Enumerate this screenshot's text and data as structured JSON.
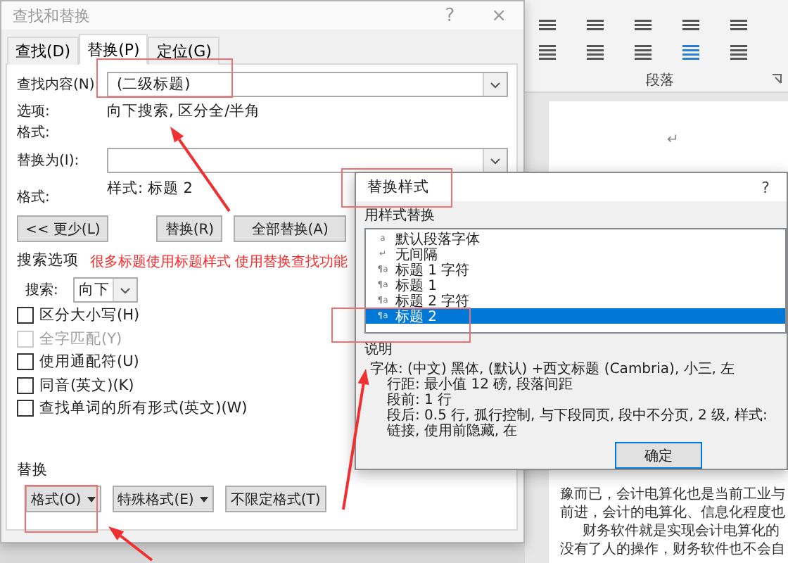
{
  "main_dialog": {
    "title": "查找和替换",
    "help": "?",
    "close": "×",
    "tabs": [
      {
        "label": "查找(D)",
        "selected": false
      },
      {
        "label": "替换(P)",
        "selected": true
      },
      {
        "label": "定位(G)",
        "selected": false
      }
    ],
    "find": {
      "label": "查找内容(N):",
      "value": "(二级标题)"
    },
    "options": {
      "label": "选项:",
      "value": "向下搜索, 区分全/半角"
    },
    "find_format": {
      "label": "格式:"
    },
    "replace": {
      "label": "替换为(I):"
    },
    "replace_format": {
      "label": "格式:",
      "value": "样式: 标题 2"
    },
    "buttons": [
      "<< 更少(L)",
      "替换(R)",
      "全部替换(A)"
    ],
    "search_options": {
      "title": "搜索选项",
      "direction_label": "搜索:",
      "direction": "向下",
      "checkboxes": [
        {
          "label": "区分大小写(H)",
          "checked": false,
          "disabled": false
        },
        {
          "label": "全字匹配(Y)",
          "checked": false,
          "disabled": true
        },
        {
          "label": "使用通配符(U)",
          "checked": false,
          "disabled": false
        },
        {
          "label": "同音(英文)(K)",
          "checked": false,
          "disabled": false
        },
        {
          "label": "查找单词的所有形式(英文)(W)",
          "checked": false,
          "disabled": false
        }
      ]
    },
    "replace_section": {
      "title": "替换",
      "buttons": [
        {
          "label": "格式(O)",
          "dropdown": true
        },
        {
          "label": "特殊格式(E)",
          "dropdown": true
        },
        {
          "label": "不限定格式(T)",
          "dropdown": false
        }
      ]
    }
  },
  "style_dialog": {
    "title": "替换样式",
    "help": "?",
    "list_label": "用样式替换",
    "styles": [
      {
        "icon": "a",
        "label": "默认段落字体",
        "selected": false
      },
      {
        "icon": "↵",
        "label": "无间隔",
        "selected": false
      },
      {
        "icon": "¶a",
        "label": "标题 1 字符",
        "selected": false
      },
      {
        "icon": "¶a",
        "label": "标题 1",
        "selected": false
      },
      {
        "icon": "¶a",
        "label": "标题 2 字符",
        "selected": false
      },
      {
        "icon": "¶a",
        "label": "标题 2",
        "selected": true
      }
    ],
    "description_label": "说明",
    "description": [
      "字体: (中文) 黑体, (默认) +西文标题 (Cambria), 小三, 左",
      "行距: 最小值 12 磅, 段落间距",
      "段前: 1 行",
      "段后: 0.5 行, 孤行控制, 与下段同页, 段中不分页, 2 级, 样式: 链接, 使用前隐藏, 在"
    ],
    "buttons": [
      "确定"
    ]
  },
  "document": {
    "group_label": "段落",
    "paragraph_mark": "↵",
    "lines": [
      {
        "text": "豫而已，会计电算化也是当前工业与",
        "indent": false
      },
      {
        "text": "前进，会计的电算化、信息化程度也",
        "indent": false
      },
      {
        "text": "财务软件就是实现会计电算化的",
        "indent": true
      },
      {
        "text": "没有了人的操作，财务软件也不会自",
        "indent": false
      }
    ]
  },
  "annotation": {
    "text": "很多标题使用标题样式 使用替换查找功能"
  }
}
